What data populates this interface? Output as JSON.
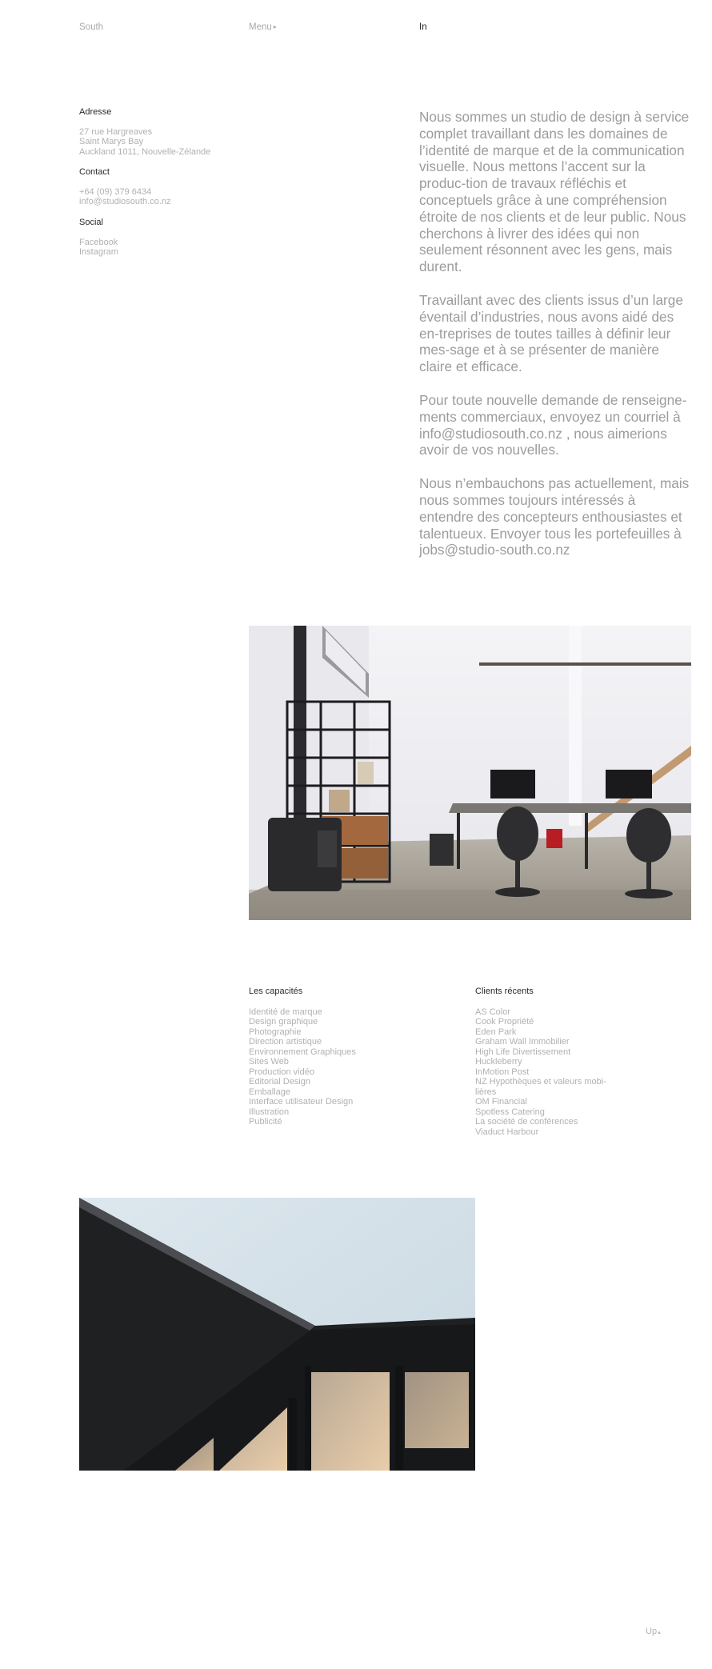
{
  "nav": {
    "brand": "South",
    "menu_label": "Menu",
    "menu_arrow": "▸",
    "in_label": "In"
  },
  "contact": {
    "address_heading": "Adresse",
    "address_lines": [
      "27 rue Hargreaves",
      "Saint Marys Bay",
      "Auckland 1011, Nouvelle-Zélande"
    ],
    "contact_heading": "Contact",
    "contact_lines": [
      "+64 (09) 379 6434",
      "info@studiosouth.co.nz"
    ],
    "social_heading": "Social",
    "social_links": [
      "Facebook",
      "Instagram"
    ]
  },
  "about": {
    "paragraphs": [
      "Nous sommes un studio de design à service complet travaillant dans les domaines de l’identité de marque et de la communication visuelle. Nous mettons l’accent sur la produc-tion de travaux réfléchis et conceptuels grâce à une compréhension étroite de nos clients et de leur public. Nous cherchons à livrer des idées qui non seulement résonnent avec les gens, mais durent.",
      "Travaillant avec des clients issus d’un large éventail d’industries, nous avons aidé des en-treprises de toutes tailles à définir leur mes-sage et à se présenter de manière claire et efficace.",
      "Pour toute nouvelle demande de renseigne-ments commerciaux, envoyez un courriel à info@studiosouth.co.nz , nous aimerions avoir de vos nouvelles.",
      "Nous n’embauchons pas actuellement, mais nous sommes toujours intéressés à entendre des concepteurs enthousiastes et talentueux. Envoyer tous les portefeuilles à jobs@studio-south.co.nz"
    ]
  },
  "capabilities": {
    "heading": "Les capacités",
    "items": [
      "Identité de marque",
      "Design graphique",
      "Photographie",
      "Direction artistique",
      "Environnement Graphiques",
      "Sites Web",
      "Production vidéo",
      "Editorial Design",
      "Emballage",
      "Interface utilisateur Design",
      "Illustration",
      "Publicité"
    ]
  },
  "clients": {
    "heading": "Clients récents",
    "items": [
      "AS Color",
      "Cook Propriété",
      "Eden Park",
      "Graham Wall Immobilier",
      "High Life Divertissement",
      "Huckleberry",
      "InMotion Post",
      "NZ Hypothèques et valeurs mobi-",
      "lières",
      "OM Financial",
      "Spotless Catering",
      "La société de conférences",
      "Viaduct Harbour"
    ]
  },
  "footer": {
    "up_label": "Up",
    "up_arrow": "▴"
  },
  "colors": {
    "background": "#ffffff",
    "text_muted": "#a9a9a9",
    "text_dark": "#222222"
  },
  "icons": {
    "menu_arrow": "triangle-right-icon",
    "up_arrow": "triangle-up-icon"
  }
}
